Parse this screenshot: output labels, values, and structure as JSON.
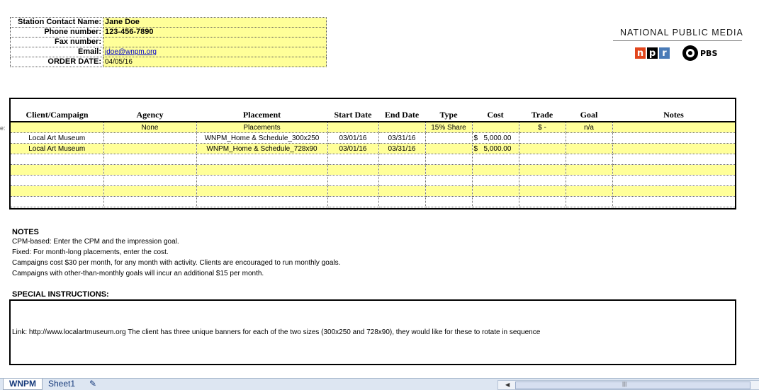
{
  "contact": {
    "rows": [
      {
        "label": "Station Contact Name:",
        "value": "Jane Doe"
      },
      {
        "label": "Phone number:",
        "value": "123-456-7890"
      },
      {
        "label": "Fax number:",
        "value": ""
      },
      {
        "label": "Email:",
        "value": "jdoe@wnpm.org"
      },
      {
        "label": "ORDER DATE:",
        "value": "04/05/16"
      }
    ]
  },
  "logo": {
    "org_name": "NATIONAL PUBLIC MEDIA",
    "npr_letters": [
      "n",
      "p",
      "r"
    ],
    "pbs_text": "PBS"
  },
  "order": {
    "headers": [
      "Client/Campaign",
      "Agency",
      "Placement",
      "Start Date",
      "End Date",
      "Type",
      "Cost",
      "Trade",
      "Goal",
      "Notes"
    ],
    "default_row": {
      "agency": "None",
      "placement": "Placements",
      "type": "15% Share",
      "trade": "$        -",
      "goal": "n/a"
    },
    "rows": [
      {
        "client": "Local Art Museum",
        "agency": "",
        "placement": "WNPM_Home & Schedule_300x250",
        "start": "03/01/16",
        "end": "03/31/16",
        "type": "",
        "cost_symbol": "$",
        "cost": "5,000.00",
        "trade": "",
        "goal": "",
        "notes": ""
      },
      {
        "client": "Local Art Museum",
        "agency": "",
        "placement": "WNPM_Home & Schedule_728x90",
        "start": "03/01/16",
        "end": "03/31/16",
        "type": "",
        "cost_symbol": "$",
        "cost": "5,000.00",
        "trade": "",
        "goal": "",
        "notes": ""
      }
    ],
    "left_stub": "e:"
  },
  "notes": {
    "heading": "NOTES",
    "lines": [
      "CPM-based: Enter the CPM and the impression goal.",
      "Fixed: For month-long placements, enter the cost.",
      "Campaigns cost $30 per month, for any month with activity. Clients are encouraged to run monthly goals.",
      "Campaigns with other-than-monthly goals will incur an additional $15 per month."
    ]
  },
  "special": {
    "heading": "SPECIAL INSTRUCTIONS:",
    "text": "Link:     http://www.localartmuseum.org  The client has three unique banners for each of the two sizes (300x250 and 728x90), they would like for these to rotate in sequence"
  },
  "tabs": {
    "active": "WNPM",
    "other": "Sheet1"
  }
}
